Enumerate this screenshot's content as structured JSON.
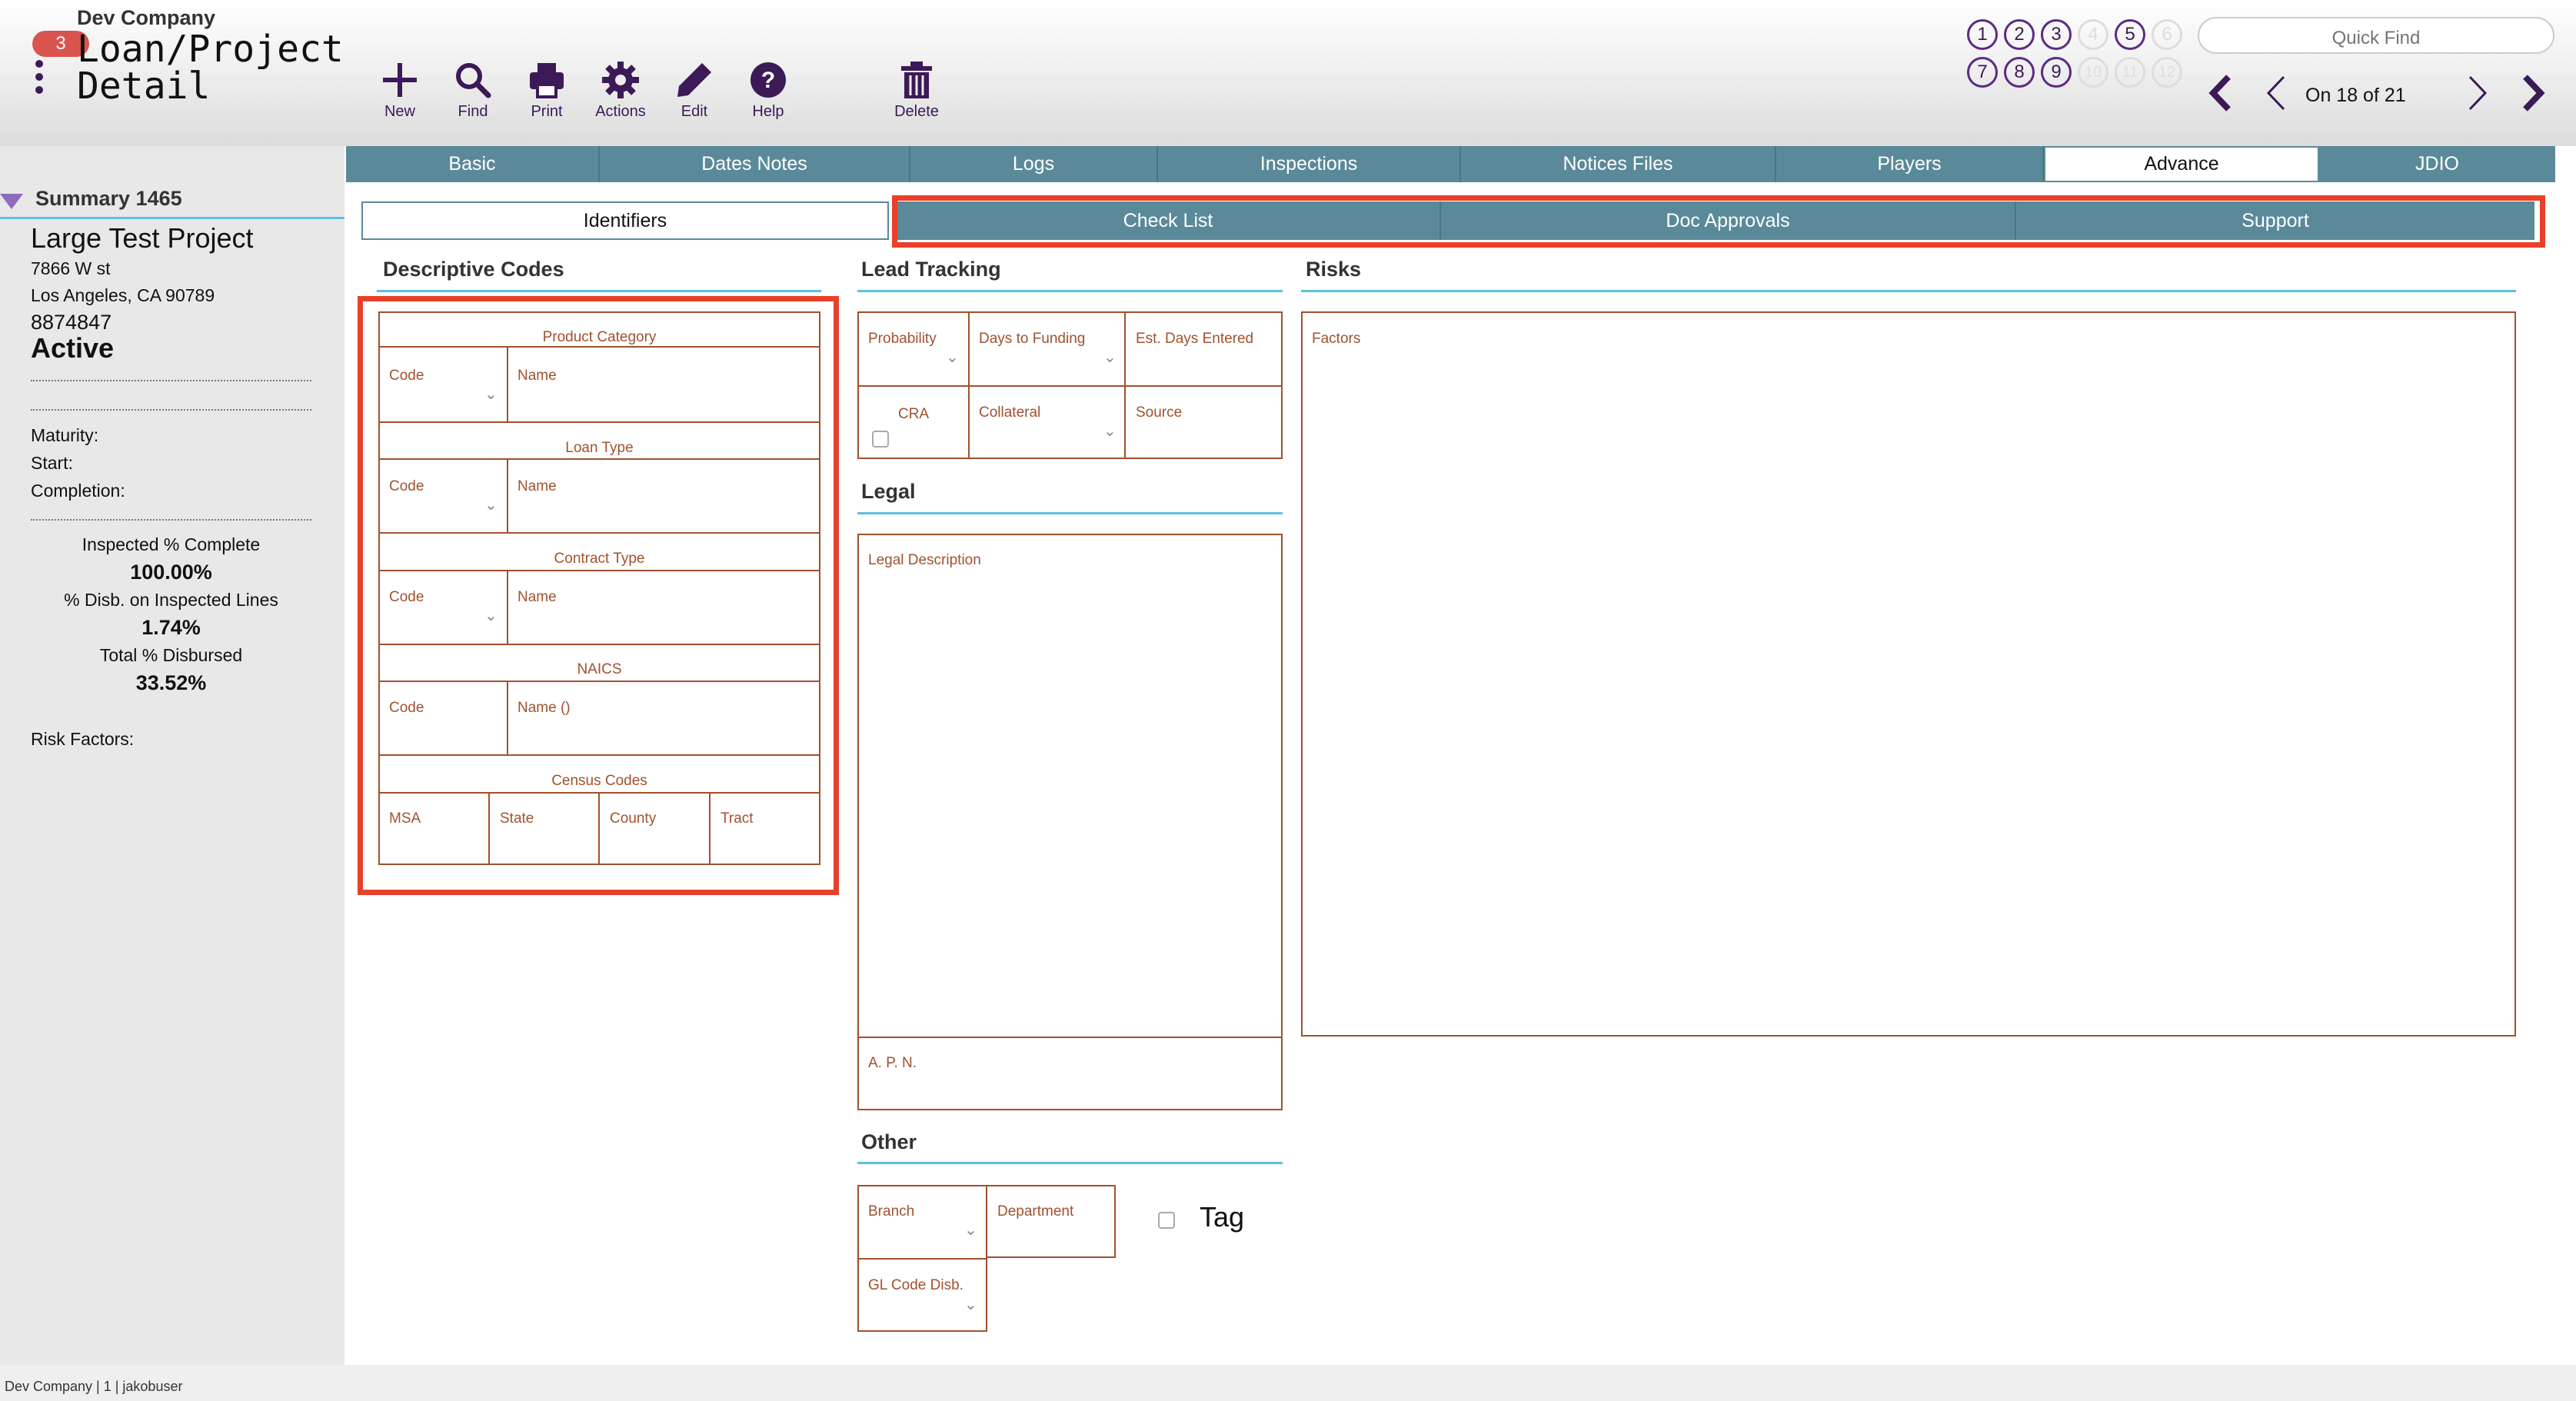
{
  "header": {
    "company": "Dev Company",
    "badge_count": "3",
    "title_line1": "Loan/Project",
    "title_line2": "Detail",
    "toolbar": {
      "new": "New",
      "find": "Find",
      "print": "Print",
      "actions": "Actions",
      "edit": "Edit",
      "help": "Help",
      "delete": "Delete"
    },
    "quick_find_placeholder": "Quick Find",
    "record_position": "On 18 of 21",
    "windows_row1": [
      "1",
      "2",
      "3",
      "4",
      "5",
      "6"
    ],
    "windows_row2": [
      "7",
      "8",
      "9",
      "10",
      "11",
      "12"
    ],
    "active_windows": [
      "1",
      "2",
      "3",
      "5",
      "7",
      "8",
      "9"
    ]
  },
  "sidebar": {
    "section_title": "Summary 1465",
    "project_name": "Large Test Project",
    "address1": "7866 W st",
    "address2": "Los Angeles, CA  90789",
    "loan_number": "8874847",
    "status": "Active",
    "maturity_label": "Maturity:",
    "start_label": "Start:",
    "completion_label": "Completion:",
    "inspected_label": "Inspected % Complete",
    "inspected_value": "100.00%",
    "disb_inspected_label": "% Disb. on Inspected Lines",
    "disb_inspected_value": "1.74%",
    "total_disbursed_label": "Total % Disbursed",
    "total_disbursed_value": "33.52%",
    "risk_factors_label": "Risk Factors:"
  },
  "main_tabs": [
    "Basic",
    "Dates Notes",
    "Logs",
    "Inspections",
    "Notices Files",
    "Players",
    "Advance",
    "JDIO"
  ],
  "active_main_tab": "Advance",
  "sub_tabs": [
    "Identifiers",
    "Check List",
    "Doc Approvals",
    "Support"
  ],
  "active_sub_tab": "Identifiers",
  "descriptive_codes": {
    "title": "Descriptive Codes",
    "product_category": "Product Category",
    "loan_type": "Loan Type",
    "contract_type": "Contract Type",
    "naics": "NAICS",
    "census_codes": "Census Codes",
    "code": "Code",
    "name": "Name",
    "name_naics": "Name ()",
    "msa": "MSA",
    "state": "State",
    "county": "County",
    "tract": "Tract"
  },
  "lead_tracking": {
    "title": "Lead Tracking",
    "probability": "Probability",
    "days_to_funding": "Days to Funding",
    "est_days_entered": "Est. Days Entered",
    "cra": "CRA",
    "collateral": "Collateral",
    "source": "Source"
  },
  "legal": {
    "title": "Legal",
    "legal_description": "Legal Description",
    "apn": "A. P. N."
  },
  "other": {
    "title": "Other",
    "branch": "Branch",
    "department": "Department",
    "gl_code": "GL Code Disb.",
    "tag": "Tag"
  },
  "risks": {
    "title": "Risks",
    "factors": "Factors"
  },
  "footer": {
    "text": "Dev Company | 1 | jakobuser"
  },
  "colors": {
    "accent": "#3b1a57",
    "tab_bg": "#5a8a99",
    "field_border": "#a0522d",
    "highlight": "#e8402a",
    "section_line": "#5bc0de"
  }
}
